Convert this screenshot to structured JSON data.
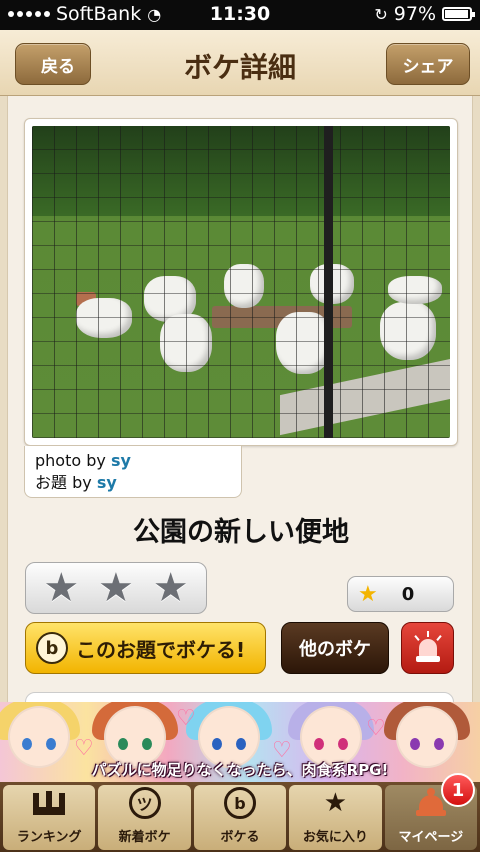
{
  "status_bar": {
    "carrier": "SoftBank",
    "time": "11:30",
    "battery": "97%",
    "battery_level": 0.97
  },
  "nav": {
    "back_label": "戻る",
    "title": "ボケ詳細",
    "share_label": "シェア"
  },
  "photo": {
    "credit_photo_prefix": "photo by",
    "credit_photo_user": "sy",
    "credit_topic_prefix": "お題 by",
    "credit_topic_user": "sy"
  },
  "boke": {
    "text": "公園の新しい便地",
    "rating_stars": 3,
    "favorite_count": "0"
  },
  "actions": {
    "boke_icon": "b",
    "boke_button": "このお題でボケる!",
    "other_button": "他のボケ",
    "report_icon": "siren-icon"
  },
  "ad": {
    "caption": "パズルに物足りなくなったら、肉食系RPG!"
  },
  "tabs": [
    {
      "label": "ランキング",
      "icon": "crown-icon"
    },
    {
      "label": "新着ボケ",
      "icon": "face-icon"
    },
    {
      "label": "ボケる",
      "icon": "b-icon"
    },
    {
      "label": "お気に入り",
      "icon": "star-icon"
    },
    {
      "label": "マイページ",
      "icon": "bell-icon",
      "badge": "1",
      "active": true
    }
  ]
}
